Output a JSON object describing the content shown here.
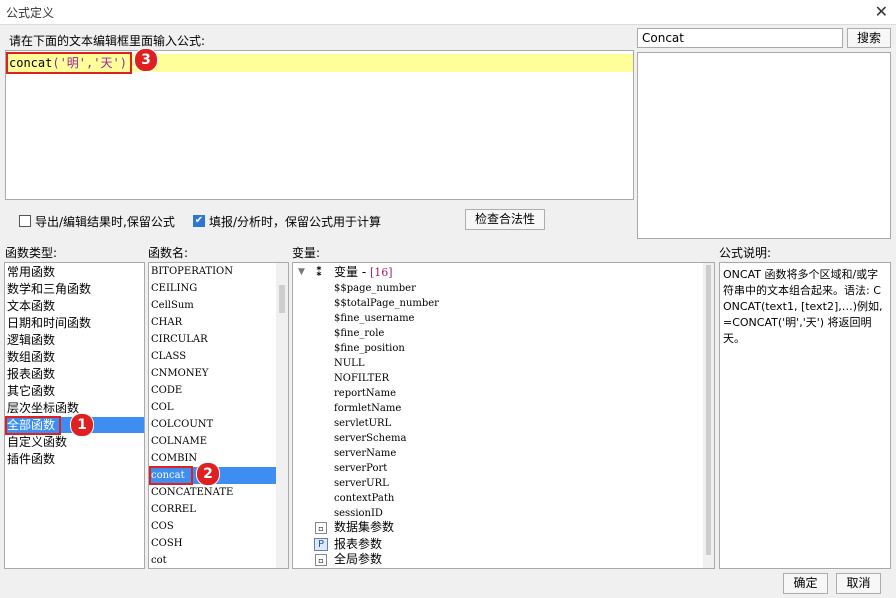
{
  "window": {
    "title": "公式定义",
    "close_glyph": "✕"
  },
  "editor": {
    "prompt": "请在下面的文本编辑框里面输入公式:",
    "formula_prefix": "concat",
    "formula_args": "('明','天')"
  },
  "search": {
    "value": "Concat",
    "button": "搜索"
  },
  "options": {
    "keep_formula_label": "导出/编辑结果时,保留公式",
    "keep_formula_checked": false,
    "fill_label": "填报/分析时，保留公式用于计算",
    "fill_checked": true,
    "check_button": "检查合法性"
  },
  "categories": {
    "header": "函数类型:",
    "items": [
      "常用函数",
      "数学和三角函数",
      "文本函数",
      "日期和时间函数",
      "逻辑函数",
      "数组函数",
      "报表函数",
      "其它函数",
      "层次坐标函数",
      "全部函数",
      "自定义函数",
      "插件函数"
    ],
    "selected": "全部函数"
  },
  "functions": {
    "header": "函数名:",
    "items": [
      "BITOPERATION",
      "CEILING",
      "CellSum",
      "CHAR",
      "CIRCULAR",
      "CLASS",
      "CNMONEY",
      "CODE",
      "COL",
      "COLCOUNT",
      "COLNAME",
      "COMBIN",
      "concat",
      "CONCATENATE",
      "CORREL",
      "COS",
      "COSH",
      "cot"
    ],
    "selected": "concat"
  },
  "variables": {
    "header": "变量:",
    "root_label": "变量 - ",
    "root_count": "[16]",
    "items": [
      "$$page_number",
      "$$totalPage_number",
      "$fine_username",
      "$fine_role",
      "$fine_position",
      "NULL",
      "NOFILTER",
      "reportName",
      "formletName",
      "servletURL",
      "serverSchema",
      "serverName",
      "serverPort",
      "serverURL",
      "contextPath",
      "sessionID"
    ],
    "groups": [
      "数据集参数",
      "报表参数",
      "全局参数"
    ]
  },
  "description": {
    "header": "公式说明:",
    "text": "ONCAT 函数将多个区域和/或字符串中的文本组合起来。语法: CONCAT(text1, [text2],…)例如, =CONCAT('明','天') 将返回明天。"
  },
  "buttons": {
    "ok": "确定",
    "cancel": "取消"
  },
  "annotations": [
    "1",
    "2",
    "3"
  ],
  "colors": {
    "selection": "#3d8ef0",
    "highlight_line": "#ffff99",
    "annotation": "#e02020",
    "string_literal": "#a020a0"
  }
}
